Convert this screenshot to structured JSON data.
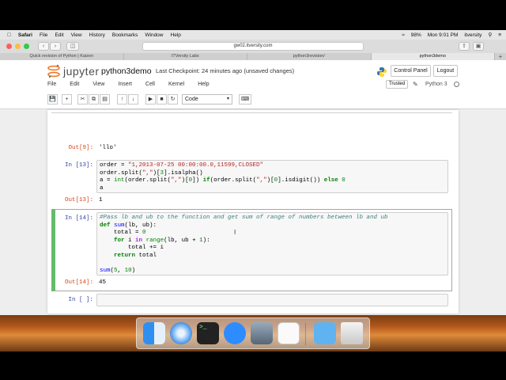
{
  "menubar": {
    "apple": "",
    "app": "Safari",
    "items": [
      "File",
      "Edit",
      "View",
      "History",
      "Bookmarks",
      "Window",
      "Help"
    ],
    "battery": "98%",
    "clock": "Mon 9:01 PM",
    "user": "itversity"
  },
  "browser": {
    "url": "gw02.itversity.com",
    "tabs": [
      {
        "label": "Quick revision of Python | Kaizen",
        "active": false
      },
      {
        "label": "ITVersity Labs",
        "active": false
      },
      {
        "label": "python3revision/",
        "active": false
      },
      {
        "label": "python3demo",
        "active": true
      }
    ]
  },
  "jupyter": {
    "logo_text": "jupyter",
    "notebook_name": "python3demo",
    "checkpoint": "Last Checkpoint: 24 minutes ago (unsaved changes)",
    "control_panel": "Control Panel",
    "logout": "Logout",
    "menu": [
      "File",
      "Edit",
      "View",
      "Insert",
      "Cell",
      "Kernel",
      "Help"
    ],
    "trusted": "Trusted",
    "kernel": "Python 3",
    "cell_type": "Code"
  },
  "cells": {
    "out9": {
      "prompt": "Out[9]:",
      "text": "'llo'"
    },
    "in13": {
      "prompt": "In [13]:"
    },
    "out13": {
      "prompt": "Out[13]:",
      "text": "1"
    },
    "in14": {
      "prompt": "In [14]:"
    },
    "out14": {
      "prompt": "Out[14]:",
      "text": "45"
    },
    "in_empty": {
      "prompt": "In [ ]:"
    }
  }
}
